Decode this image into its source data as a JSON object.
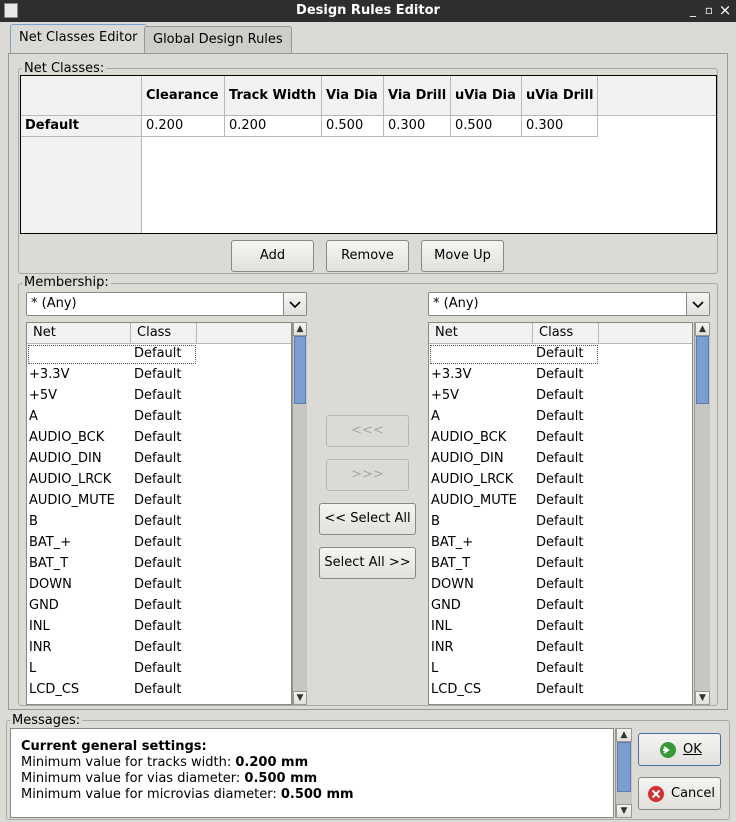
{
  "window": {
    "title": "Design Rules Editor",
    "minimize_glyph": "_",
    "maximize_glyph": "▫",
    "close_glyph": "×"
  },
  "tabs": [
    {
      "label": "Net Classes Editor",
      "active": true
    },
    {
      "label": "Global Design Rules",
      "active": false
    }
  ],
  "net_classes": {
    "group_label": "Net Classes:",
    "columns": [
      "Clearance",
      "Track Width",
      "Via Dia",
      "Via Drill",
      "uVia Dia",
      "uVia Drill"
    ],
    "rows": [
      {
        "name": "Default",
        "values": [
          "0.200",
          "0.200",
          "0.500",
          "0.300",
          "0.500",
          "0.300"
        ]
      }
    ],
    "buttons": {
      "add": "Add",
      "remove": "Remove",
      "move_up": "Move Up"
    }
  },
  "membership": {
    "group_label": "Membership:",
    "left_filter": "* (Any)",
    "right_filter": "* (Any)",
    "columns": {
      "net": "Net",
      "class": "Class"
    },
    "nets": [
      {
        "net": "",
        "class": "Default"
      },
      {
        "net": "+3.3V",
        "class": "Default"
      },
      {
        "net": "+5V",
        "class": "Default"
      },
      {
        "net": "A",
        "class": "Default"
      },
      {
        "net": "AUDIO_BCK",
        "class": "Default"
      },
      {
        "net": "AUDIO_DIN",
        "class": "Default"
      },
      {
        "net": "AUDIO_LRCK",
        "class": "Default"
      },
      {
        "net": "AUDIO_MUTE",
        "class": "Default"
      },
      {
        "net": "B",
        "class": "Default"
      },
      {
        "net": "BAT_+",
        "class": "Default"
      },
      {
        "net": "BAT_T",
        "class": "Default"
      },
      {
        "net": "DOWN",
        "class": "Default"
      },
      {
        "net": "GND",
        "class": "Default"
      },
      {
        "net": "INL",
        "class": "Default"
      },
      {
        "net": "INR",
        "class": "Default"
      },
      {
        "net": "L",
        "class": "Default"
      },
      {
        "net": "LCD_CS",
        "class": "Default"
      }
    ],
    "buttons": {
      "move_left": "<<<",
      "move_right": ">>>",
      "select_all_left": "<< Select All",
      "select_all_right": "Select All >>"
    }
  },
  "messages": {
    "group_label": "Messages:",
    "heading": "Current general settings:",
    "lines": [
      {
        "label": "Minimum value for tracks width: ",
        "value": "0.200 mm"
      },
      {
        "label": "Minimum value for vias diameter: ",
        "value": "0.500 mm"
      },
      {
        "label": "Minimum value for microvias diameter: ",
        "value": "0.500 mm"
      }
    ]
  },
  "dialog_buttons": {
    "ok": "OK",
    "cancel": "Cancel"
  },
  "icons": {
    "ok": "check-circle-icon",
    "cancel": "x-circle-icon"
  },
  "colors": {
    "ok_green": "#3a9a3a",
    "cancel_red": "#d03030",
    "scroll_thumb": "#7a9ed0",
    "titlebar": "#2e2e2e"
  }
}
